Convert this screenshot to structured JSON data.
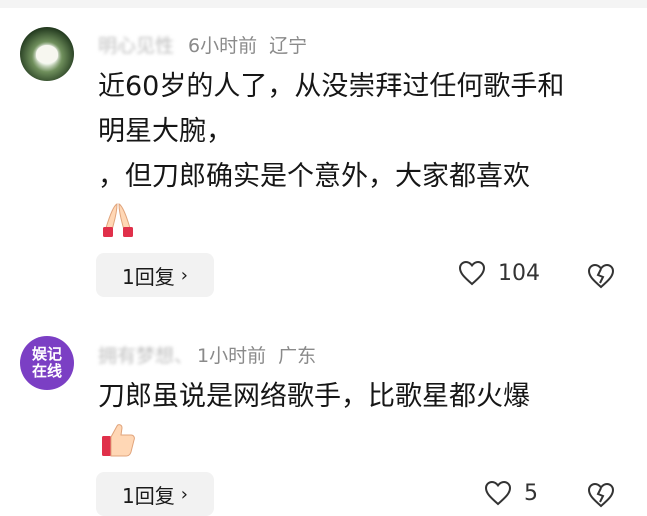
{
  "comments": [
    {
      "username": "明心见性",
      "time": "6小时前",
      "location": "辽宁",
      "lines": [
        "近60岁的人了，从没崇拜过任何歌手和",
        "明星大腕，",
        "，但刀郎确实是个意外，大家都喜欢"
      ],
      "emoji_icon": "praying-hands-icon",
      "reply_label": "1回复",
      "likes": "104"
    },
    {
      "username": "拥有梦想、",
      "avatar_text_top": "娱记",
      "avatar_text_bottom": "在线",
      "time": "1小时前",
      "location": "广东",
      "lines": [
        "刀郎虽说是网络歌手，比歌星都火爆"
      ],
      "emoji_icon": "thumbs-up-icon",
      "reply_label": "1回复",
      "likes": "5"
    }
  ]
}
